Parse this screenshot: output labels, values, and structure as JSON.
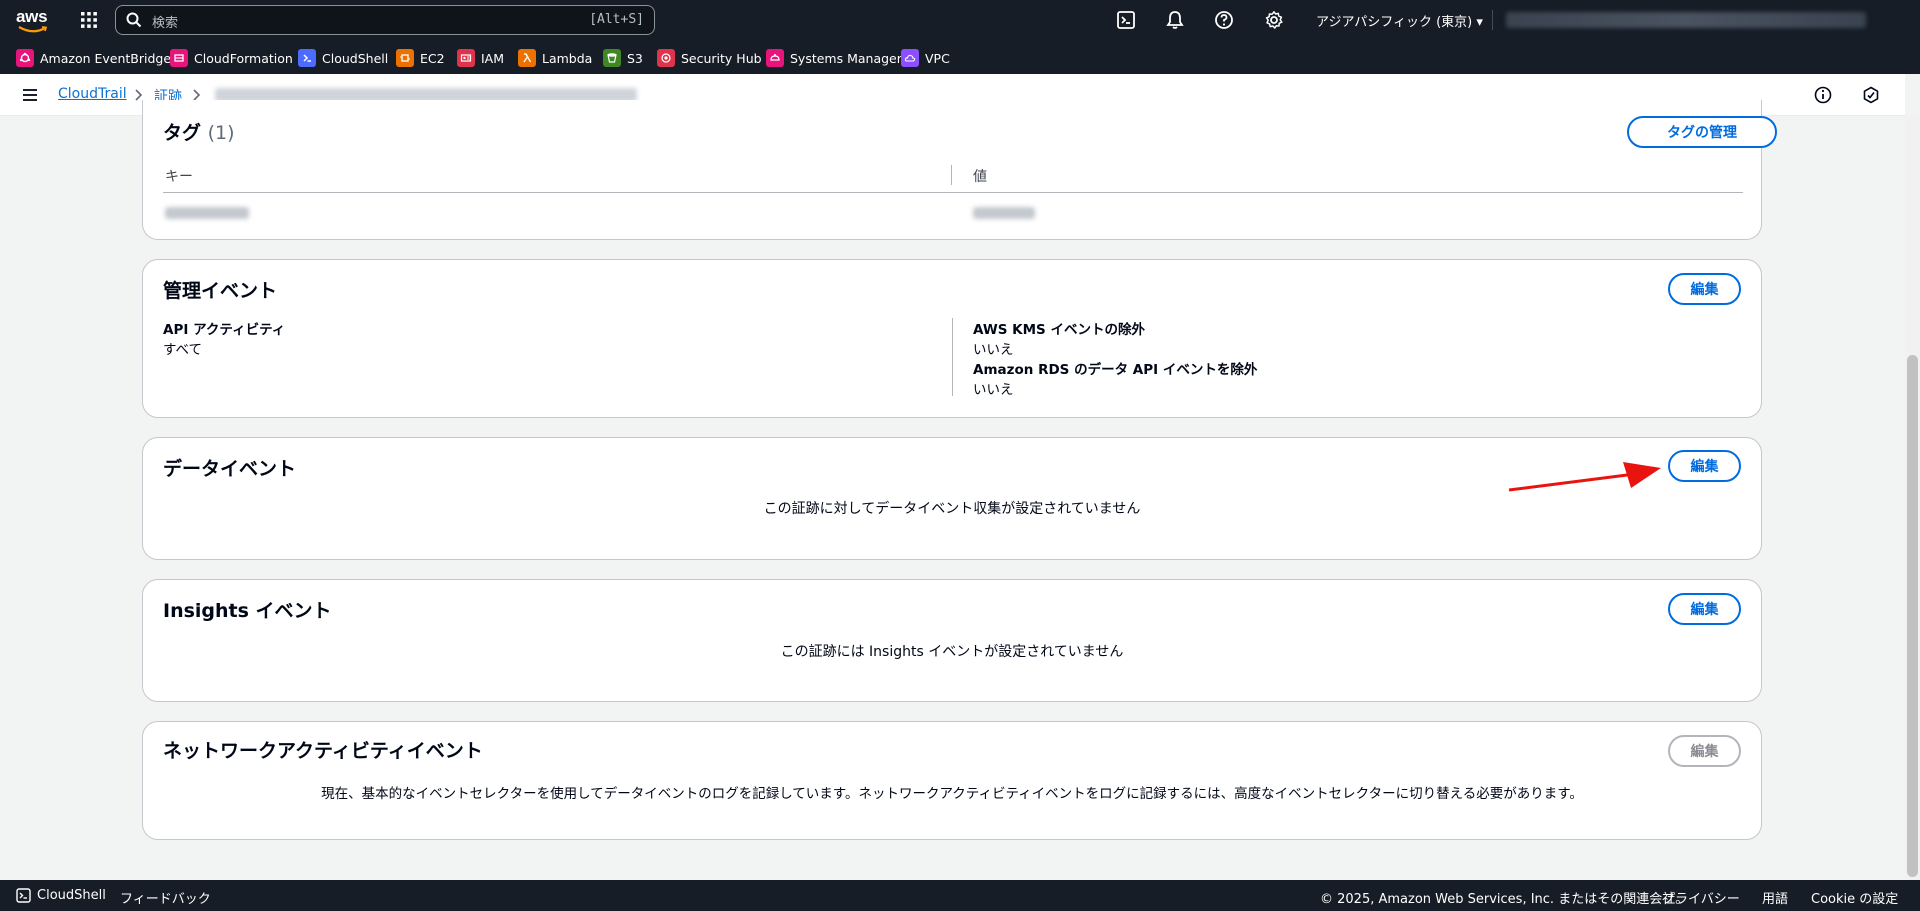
{
  "topnav": {
    "logo_text": "aws",
    "search_placeholder": "検索",
    "search_shortcut": "[Alt+S]",
    "region": "アジアパシフィック (東京) ▾"
  },
  "favorites": [
    {
      "label": "Amazon EventBridge",
      "color": "#e7157b"
    },
    {
      "label": "CloudFormation",
      "color": "#e7157b"
    },
    {
      "label": "CloudShell",
      "color": "#4d6bfe"
    },
    {
      "label": "EC2",
      "color": "#ed7100"
    },
    {
      "label": "IAM",
      "color": "#dd344c"
    },
    {
      "label": "Lambda",
      "color": "#ed7100"
    },
    {
      "label": "S3",
      "color": "#3f8624"
    },
    {
      "label": "Security Hub",
      "color": "#dd344c"
    },
    {
      "label": "Systems Manager",
      "color": "#e7157b"
    },
    {
      "label": "VPC",
      "color": "#8c4fff"
    }
  ],
  "breadcrumb": {
    "root": "CloudTrail",
    "second": "証跡"
  },
  "tags_panel": {
    "title": "タグ",
    "count": "(1)",
    "manage_button": "タグの管理",
    "col_key": "キー",
    "col_value": "値"
  },
  "mgmt_panel": {
    "title": "管理イベント",
    "edit_button": "編集",
    "api_activity_label": "API アクティビティ",
    "api_activity_value": "すべて",
    "kms_label": "AWS KMS イベントの除外",
    "kms_value": "いいえ",
    "rds_label": "Amazon RDS のデータ API イベントを除外",
    "rds_value": "いいえ"
  },
  "data_panel": {
    "title": "データイベント",
    "edit_button": "編集",
    "empty_text": "この証跡に対してデータイベント収集が設定されていません"
  },
  "insights_panel": {
    "title": "Insights イベント",
    "edit_button": "編集",
    "empty_text": "この証跡には Insights イベントが設定されていません"
  },
  "network_panel": {
    "title": "ネットワークアクティビティイベント",
    "edit_button": "編集",
    "message": "現在、基本的なイベントセレクターを使用してデータイベントのログを記録しています。ネットワークアクティビティイベントをログに記録するには、高度なイベントセレクターに切り替える必要があります。"
  },
  "footer": {
    "cloudshell": "CloudShell",
    "feedback": "フィードバック",
    "copyright": "© 2025, Amazon Web Services, Inc. またはその関連会社。",
    "privacy": "プライバシー",
    "terms": "用語",
    "cookie": "Cookie の設定"
  }
}
